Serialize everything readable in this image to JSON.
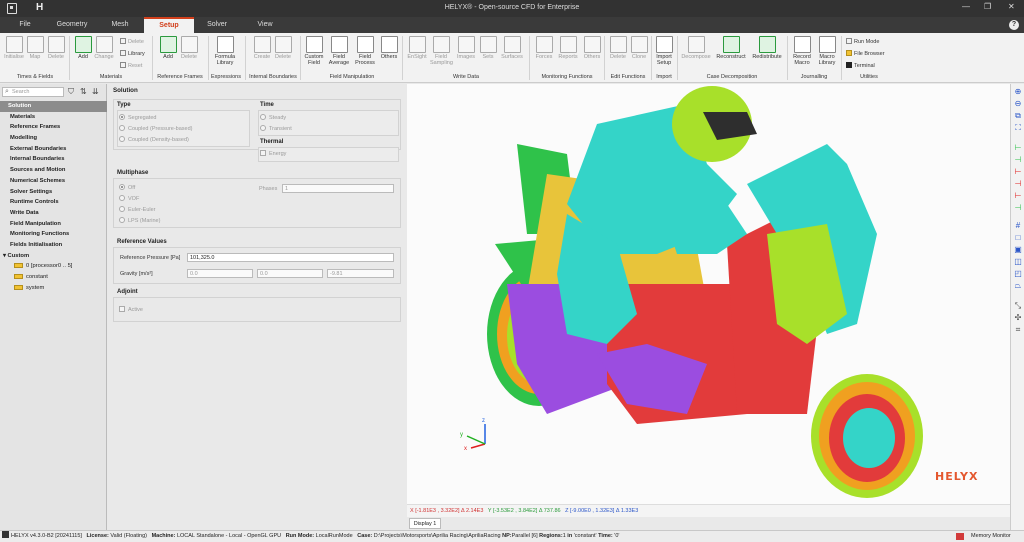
{
  "window": {
    "title": "HELYX® - Open-source CFD for Enterprise"
  },
  "tabs": [
    "File",
    "Geometry",
    "Mesh",
    "Setup",
    "Solver",
    "View"
  ],
  "active_tab": "Setup",
  "ribbon": {
    "times_fields": {
      "buttons": [
        "Initialise",
        "Map",
        "Delete"
      ],
      "label": "Times & Fields"
    },
    "materials": {
      "buttons": [
        "Add",
        "Change"
      ],
      "small": [
        "Delete",
        "Library",
        "Reset"
      ],
      "label": "Materials"
    },
    "reference_frames": {
      "buttons": [
        "Add",
        "Delete"
      ],
      "label": "Reference Frames"
    },
    "expressions": {
      "buttons": [
        "Formula Library"
      ],
      "label": "Expressions"
    },
    "internal_boundaries": {
      "buttons": [
        "Create",
        "Delete"
      ],
      "label": "Internal Boundaries"
    },
    "field_manipulation": {
      "buttons": [
        "Custom Field",
        "Field Average",
        "Field Process",
        "Others"
      ],
      "label": "Field Manipulation"
    },
    "write_data": {
      "buttons": [
        "EnSight",
        "Field Sampling",
        "Images",
        "Sets",
        "Surfaces"
      ],
      "label": "Write Data"
    },
    "monitoring_functions": {
      "buttons": [
        "Forces",
        "Reports",
        "Others"
      ],
      "label": "Monitoring Functions"
    },
    "edit_functions": {
      "buttons": [
        "Delete",
        "Clone"
      ],
      "label": "Edit Functions"
    },
    "import": {
      "buttons": [
        "Import Setup"
      ],
      "label": "Import"
    },
    "case_decomposition": {
      "buttons": [
        "Decompose",
        "Reconstruct",
        "Redistribute"
      ],
      "label": "Case Decomposition"
    },
    "journalling": {
      "buttons": [
        "Record Macro",
        "Macro Library"
      ],
      "label": "Journalling"
    },
    "utilities": {
      "buttons": [
        "Run Mode",
        "File Browser",
        "Terminal"
      ],
      "label": "Utilities"
    }
  },
  "left_panel": {
    "search_placeholder": "Search",
    "tree": [
      "Solution",
      "Materials",
      "Reference Frames",
      "Modelling",
      "External Boundaries",
      "Internal Boundaries",
      "Sources and Motion",
      "Numerical Schemes",
      "Solver Settings",
      "Runtime Controls",
      "Write Data",
      "Field Manipulation",
      "Monitoring Functions",
      "Fields Initialisation",
      "Custom"
    ],
    "custom_children": [
      "0 [processor0 .. 5]",
      "constant",
      "system"
    ]
  },
  "form": {
    "title": "Solution",
    "type": {
      "header": "Type",
      "options": [
        "Segregated",
        "Coupled (Pressure-based)",
        "Coupled (Density-based)"
      ]
    },
    "time": {
      "header": "Time",
      "options": [
        "Steady",
        "Transient"
      ]
    },
    "thermal": {
      "header": "Thermal",
      "options": [
        "Energy"
      ]
    },
    "multiphase": {
      "header": "Multiphase",
      "options": [
        "Off",
        "VOF",
        "Euler-Euler",
        "LPS (Marine)"
      ],
      "phases_label": "Phases",
      "phases_value": "1"
    },
    "reference_values": {
      "header": "Reference Values",
      "pressure_label": "Reference Pressure [Pa]",
      "pressure_value": "101,325.0",
      "gravity_label": "Gravity [m/s²]",
      "gravity": [
        "0.0",
        "0.0",
        "-9.81"
      ]
    },
    "adjoint": {
      "header": "Adjoint",
      "options": [
        "Active"
      ]
    }
  },
  "viewport": {
    "logo": "HELYX",
    "coords": {
      "x": "X [-1.81E3 , 3.32E2] Δ 2.14E3",
      "y": "Y [-3.53E2 , 3.84E2] Δ 737.86",
      "z": "Z [-9.00E0 , 1.32E3] Δ 1.33E3"
    },
    "display_tab": "Display 1"
  },
  "status": {
    "version": "HELYX v4.3.0-B2 [20241115]",
    "license_label": "License:",
    "license": "Valid (Floating)",
    "machine_label": "Machine:",
    "machine": "LOCAL Standalone - Local - OpenGL GPU",
    "runmode_label": "Run Mode:",
    "runmode": "LocalRunMode",
    "case_label": "Case:",
    "case": "D:\\Projects\\Motorsports\\Aprilia Racing\\ApriliaRacing",
    "np_label": "NP:",
    "np": "Parallel [6]",
    "regions_label": "Regions:",
    "regions": "1",
    "in_label": "in",
    "in_value": "'constant'",
    "time_label": "Time:",
    "time": "'0'",
    "memory": "Memory Monitor"
  },
  "colors": {
    "accent": "#d2401c",
    "titlebar": "#323232",
    "cyan": "#34d4c8",
    "lime": "#a8e02a",
    "red": "#e23b3b",
    "purple": "#9b4de0",
    "orange": "#f0a020",
    "green": "#2fc24a",
    "yellow": "#e8c43a"
  }
}
